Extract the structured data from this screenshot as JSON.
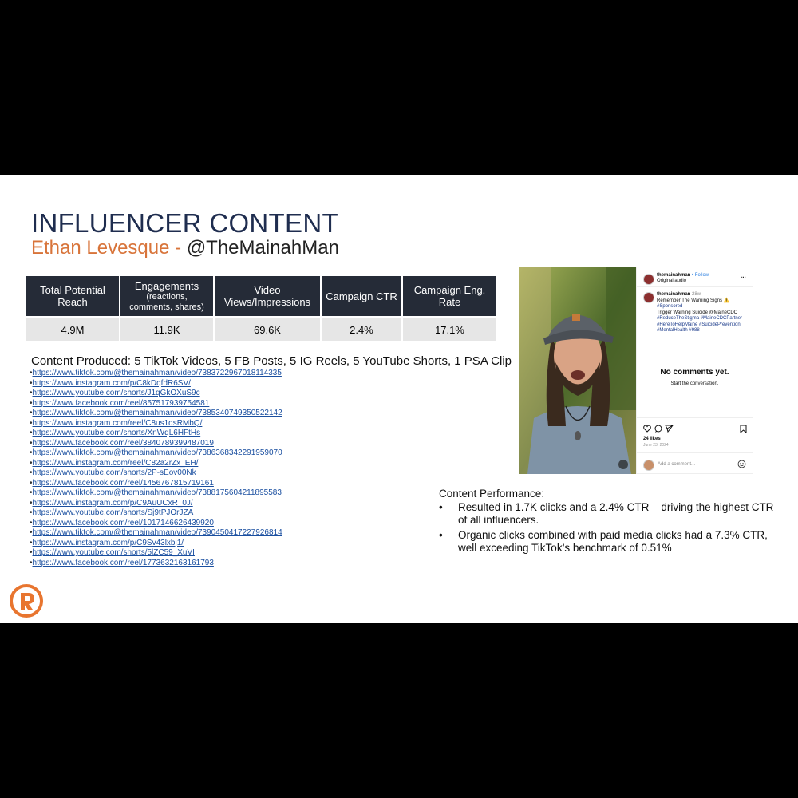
{
  "title": "INFLUENCER CONTENT",
  "subtitle": {
    "name": "Ethan Levesque - ",
    "handle": "@TheMainahMan"
  },
  "metrics": {
    "headers": [
      {
        "label": "Total Potential Reach",
        "sub": ""
      },
      {
        "label": "Engagements",
        "sub": "(reactions, comments, shares)"
      },
      {
        "label": "Video Views/Impressions",
        "sub": ""
      },
      {
        "label": "Campaign CTR",
        "sub": ""
      },
      {
        "label": "Campaign Eng. Rate",
        "sub": ""
      }
    ],
    "values": [
      "4.9M",
      "11.9K",
      "69.6K",
      "2.4%",
      "17.1%"
    ]
  },
  "produced": "Content Produced: 5 TikTok Videos, 5 FB Posts, 5 IG Reels, 5 YouTube Shorts, 1 PSA Clip",
  "links": [
    "https://www.tiktok.com/@themainahman/video/7383722967018114335",
    "https://www.instagram.com/p/C8kDqfdR6SV/",
    "https://www.youtube.com/shorts/J1qGkOXuS9c",
    "https://www.facebook.com/reel/857517939754581",
    "https://www.tiktok.com/@themainahman/video/7385340749350522142",
    "https://www.instagram.com/reel/C8us1dsRMbQ/",
    "https://www.youtube.com/shorts/XnWqL6HFtHs",
    "https://www.facebook.com/reel/3840789399487019",
    "https://www.tiktok.com/@themainahman/video/7386368342291959070",
    "https://www.instagram.com/reel/C82a2rZx_EH/",
    "https://www.youtube.com/shorts/2P-sEov00Nk",
    "https://www.facebook.com/reel/1456767815719161",
    "https://www.tiktok.com/@themainahman/video/7388175604211895583",
    "https://www.instagram.com/p/C9AuUCxR_0J/",
    "https://www.youtube.com/shorts/Sj9tPJOrJZA",
    "https://www.facebook.com/reel/1017146626439920",
    "https://www.tiktok.com/@themainahman/video/7390450417227926814",
    "https://www.instagram.com/p/C9Sv43lxbj1/",
    "https://www.youtube.com/shorts/5lZC59_XuVI",
    "https://www.facebook.com/reel/1773632163161793"
  ],
  "instagram": {
    "username": "themainahman",
    "follow": "• Follow",
    "audio": "Original audio",
    "more": "...",
    "age": "28w",
    "caption_lines": [
      "Remember The Warning Signs ⚠️",
      "#Sponsored",
      "Trigger Warning Suicide @MaineCDC",
      "#ReduceTheStigma #MaineCDCPartner",
      "#HereToHelpMaine #SuicidePrevention",
      "#MentalHealth #988"
    ],
    "no_comments": "No comments yet.",
    "start_conversation": "Start the conversation.",
    "likes": "24 likes",
    "date": "June 23, 2024",
    "add_comment": "Add a comment..."
  },
  "performance": {
    "heading": "Content Performance:",
    "bullets": [
      "Resulted in 1.7K clicks and a 2.4% CTR – driving the highest CTR of all influencers.",
      "Organic clicks combined with paid media clicks had a 7.3% CTR, well exceeding TikTok’s benchmark of 0.51%"
    ]
  },
  "colors": {
    "title": "#1f2d4f",
    "accent": "#d8743a",
    "table_header": "#252b37",
    "table_row": "#e6e6e6",
    "link": "#1a4fa0",
    "logo": "#e8752f"
  }
}
